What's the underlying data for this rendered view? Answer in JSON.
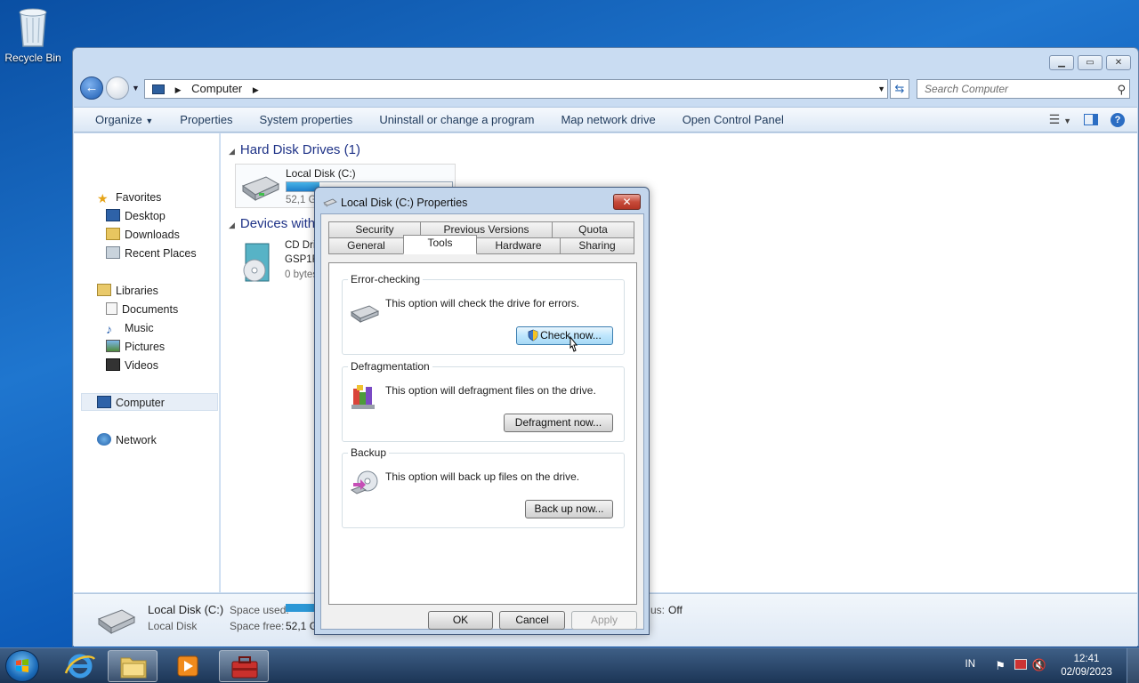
{
  "desktop": {
    "recycle_bin_label": "Recycle Bin"
  },
  "explorer": {
    "address_location": "Computer",
    "search_placeholder": "Search Computer",
    "commands": [
      "Organize",
      "Properties",
      "System properties",
      "Uninstall or change a program",
      "Map network drive",
      "Open Control Panel"
    ],
    "nav": {
      "favorites": "Favorites",
      "desktop": "Desktop",
      "downloads": "Downloads",
      "recent_places": "Recent Places",
      "libraries": "Libraries",
      "documents": "Documents",
      "music": "Music",
      "pictures": "Pictures",
      "videos": "Videos",
      "computer": "Computer",
      "network": "Network"
    },
    "groups": {
      "hard_disk_drives": "Hard Disk Drives (1)",
      "devices_removable": "Devices with"
    },
    "local_disk": {
      "name": "Local Disk (C:)",
      "free_text": "52,1 Gl",
      "used_fraction": 0.2
    },
    "cd_drive": {
      "line1": "CD Dri",
      "line2": "GSP1R",
      "line3": "0 bytes"
    },
    "details": {
      "name": "Local Disk (C:)",
      "type": "Local Disk",
      "space_used_label": "Space used:",
      "space_free_label": "Space free:",
      "space_free_value": "52,1 Gl",
      "status_suffix": "us:",
      "status_value": "Off"
    }
  },
  "dialog": {
    "title": "Local Disk (C:) Properties",
    "close_label": "✕",
    "tabs_row1": [
      "Security",
      "Previous Versions",
      "Quota"
    ],
    "tabs_row2": [
      "General",
      "Tools",
      "Hardware",
      "Sharing"
    ],
    "active_tab": "Tools",
    "error_checking": {
      "legend": "Error-checking",
      "text": "This option will check the drive for errors.",
      "button": "Check now..."
    },
    "defragmentation": {
      "legend": "Defragmentation",
      "text": "This option will defragment files on the drive.",
      "button": "Defragment now..."
    },
    "backup": {
      "legend": "Backup",
      "text": "This option will back up files on the drive.",
      "button": "Back up now..."
    },
    "ok": "OK",
    "cancel": "Cancel",
    "apply": "Apply"
  },
  "taskbar": {
    "language": "IN",
    "time": "12:41",
    "date": "02/09/2023"
  }
}
